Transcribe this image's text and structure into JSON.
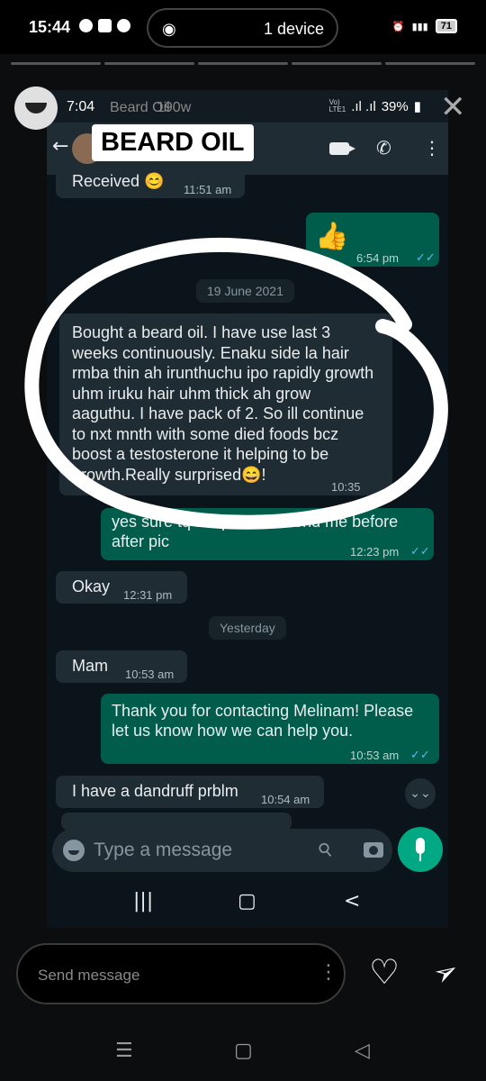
{
  "outer_status": {
    "time": "15:44",
    "device_label": "1 device",
    "battery": "71"
  },
  "story": {
    "ghost_name": "Beard Oil",
    "ghost_time": "190w",
    "reply_placeholder": "Send message"
  },
  "inner_status": {
    "time": "7:04",
    "battery": "39%"
  },
  "chat": {
    "contact_name": "BEARD OIL",
    "messages": [
      {
        "dir": "in",
        "text": "Received 😊",
        "time": "11:51 am"
      },
      {
        "dir": "out",
        "text": "👍",
        "time": "6:54 pm",
        "ticks": "✓✓"
      },
      {
        "dir": "date",
        "text": "19 June 2021"
      },
      {
        "dir": "in",
        "text": "Bought a beard oil. I have use last 3 weeks continuously. Enaku side la hair rmba thin ah irunthuchu ipo rapidly growth uhm iruku hair uhm thick ah grow aaguthu. I have pack of 2. So ill continue to nxt mnth with some died foods bcz boost a testosterone it helping to be growth.Really surprised😄!",
        "time": "10:35"
      },
      {
        "dir": "out",
        "text": "yes sure tq ...if possible send me before after pic",
        "time": "12:23 pm",
        "ticks": "✓✓"
      },
      {
        "dir": "in",
        "text": "Okay",
        "time": "12:31 pm"
      },
      {
        "dir": "date",
        "text": "Yesterday"
      },
      {
        "dir": "in",
        "text": "Mam",
        "time": "10:53 am"
      },
      {
        "dir": "out",
        "text": "Thank you for contacting Melinam! Please let us know how we can help you.",
        "time": "10:53 am",
        "ticks": "✓✓"
      },
      {
        "dir": "in",
        "text": "I have a dandruff prblm",
        "time": "10:54 am"
      }
    ],
    "input_placeholder": "Type a message"
  },
  "colors": {
    "incoming": "#202c33",
    "outgoing": "#005c4b",
    "accent": "#00a884",
    "scribble": "#ffffff"
  }
}
